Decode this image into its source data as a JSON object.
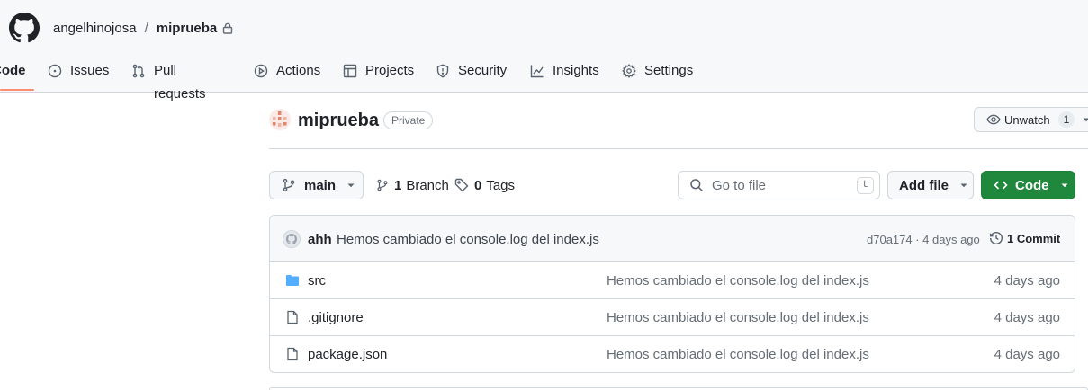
{
  "header": {
    "owner": "angelhinojosa",
    "separator": "/",
    "repo": "miprueba"
  },
  "tabs": [
    {
      "label": "Code",
      "icon": "code-icon",
      "selected": true
    },
    {
      "label": "Issues",
      "icon": "issue-opened-icon"
    },
    {
      "label": "Pull requests",
      "icon": "git-pull-request-icon"
    },
    {
      "label": "Actions",
      "icon": "play-icon"
    },
    {
      "label": "Projects",
      "icon": "table-icon"
    },
    {
      "label": "Security",
      "icon": "shield-icon"
    },
    {
      "label": "Insights",
      "icon": "graph-icon"
    },
    {
      "label": "Settings",
      "icon": "gear-icon"
    }
  ],
  "repo": {
    "title": "miprueba",
    "visibility": "Private",
    "watch_label": "Unwatch",
    "watch_count": "1"
  },
  "toolbar": {
    "branch": "main",
    "branch_count": "1",
    "branch_label": "Branch",
    "tag_count": "0",
    "tag_label": "Tags",
    "search_placeholder": "Go to file",
    "search_shortcut": "t",
    "add_file": "Add file",
    "code": "Code"
  },
  "commit": {
    "author": "ahh",
    "message": "Hemos cambiado el console.log del index.js",
    "hash_age": "d70a174 · 4 days ago",
    "count_label": "1 Commit"
  },
  "files": [
    {
      "name": "src",
      "type": "folder",
      "message": "Hemos cambiado el console.log del index.js",
      "date": "4 days ago"
    },
    {
      "name": ".gitignore",
      "type": "file",
      "message": "Hemos cambiado el console.log del index.js",
      "date": "4 days ago"
    },
    {
      "name": "package.json",
      "type": "file",
      "message": "Hemos cambiado el console.log del index.js",
      "date": "4 days ago"
    }
  ],
  "colors": {
    "primary_button": "#1f883d",
    "folder": "#54aeff",
    "tab_underline": "#fd8c73"
  }
}
